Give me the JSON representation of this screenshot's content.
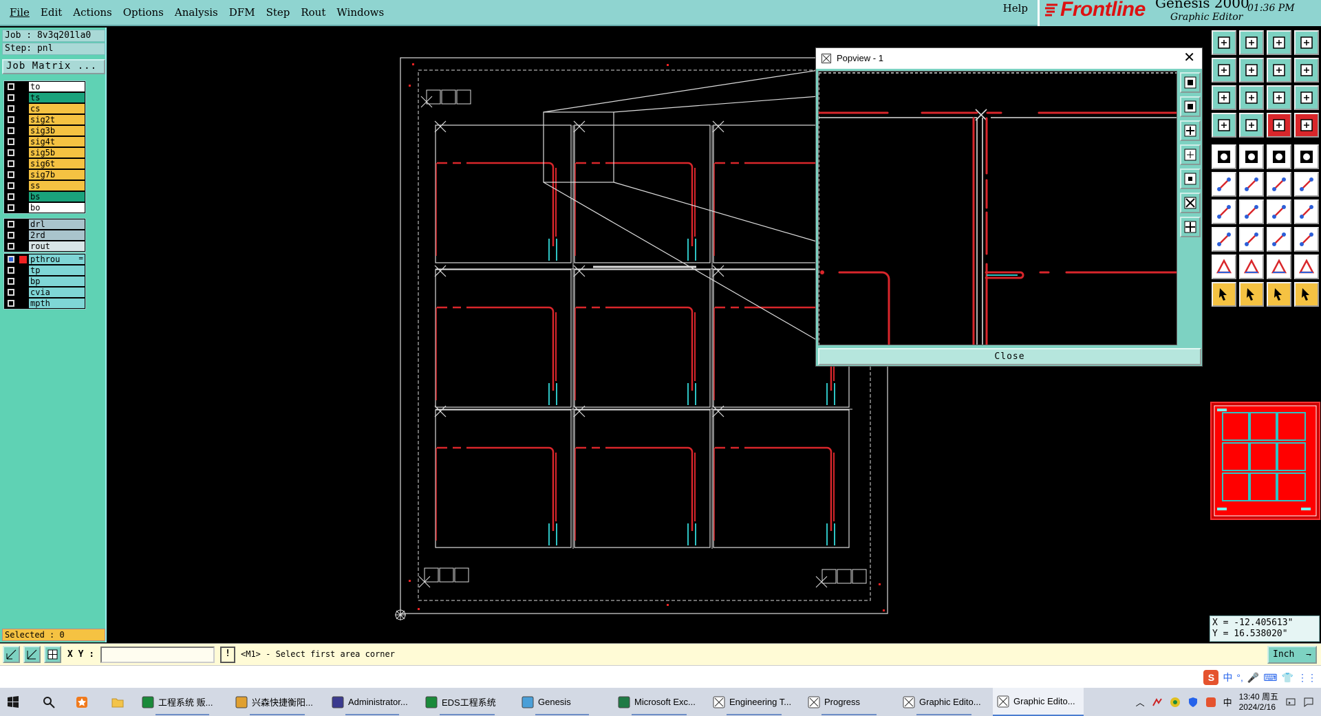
{
  "menubar": {
    "items": [
      "File",
      "Edit",
      "Actions",
      "Options",
      "Analysis",
      "DFM",
      "Step",
      "Rout",
      "Windows"
    ],
    "help": "Help"
  },
  "logo": {
    "brand": "Frontline",
    "product": "Genesis 2000",
    "subtitle": "Graphic Editor",
    "time": "01:36 PM"
  },
  "left_panel": {
    "job_line": "Job : 8v3q201la0",
    "step_line": "Step: pnl",
    "job_matrix_button": "Job Matrix ...",
    "layer_groups": [
      [
        {
          "name": "to",
          "color": "#ffffff"
        },
        {
          "name": "ts",
          "color": "#1aa37c"
        },
        {
          "name": "cs",
          "color": "#f5c242"
        },
        {
          "name": "sig2t",
          "color": "#f5c242"
        },
        {
          "name": "sig3b",
          "color": "#f5c242"
        },
        {
          "name": "sig4t",
          "color": "#f5c242"
        },
        {
          "name": "sig5b",
          "color": "#f5c242"
        },
        {
          "name": "sig6t",
          "color": "#f5c242"
        },
        {
          "name": "sig7b",
          "color": "#f5c242"
        },
        {
          "name": "ss",
          "color": "#f5c242"
        },
        {
          "name": "bs",
          "color": "#1aa37c"
        },
        {
          "name": "bo",
          "color": "#ffffff"
        }
      ],
      [
        {
          "name": "drl",
          "color": "#a9c4cc"
        },
        {
          "name": "2rd",
          "color": "#a9c4cc"
        },
        {
          "name": "rout",
          "color": "#d9e6e8"
        }
      ],
      [
        {
          "name": "pthrou",
          "color": "#7fd6d6",
          "active": true,
          "marker": "="
        },
        {
          "name": "tp",
          "color": "#7fd6d6"
        },
        {
          "name": "bp",
          "color": "#7fd6d6"
        },
        {
          "name": "cvia",
          "color": "#7fd6d6"
        },
        {
          "name": "mpth",
          "color": "#7fd6d6"
        }
      ]
    ],
    "selected": "Selected : 0"
  },
  "popview": {
    "title": "Popview - 1",
    "close_button": "Close"
  },
  "coords": {
    "x": "X = -12.405613\"",
    "y": "Y = 16.538020\""
  },
  "command_bar": {
    "xy_label": "X Y :",
    "xy_value": "",
    "prompt": "<M1> - Select first area corner",
    "units": "Inch"
  },
  "taskbar": {
    "items": [
      {
        "label": "工程系统  贩...",
        "icon_color": "#1a8a3a",
        "icon": "P"
      },
      {
        "label": "兴森快捷衡阳...",
        "icon_color": "#e0a030",
        "icon": "folder"
      },
      {
        "label": "Administrator...",
        "icon_color": "#3b3b8f",
        "icon": "disk"
      },
      {
        "label": "EDS工程系统",
        "icon_color": "#1a8a3a",
        "icon": "P"
      },
      {
        "label": "Genesis",
        "icon_color": "#4a9fd8",
        "icon": "g"
      },
      {
        "label": "Microsoft Exc...",
        "icon_color": "#1f7a45",
        "icon": "X"
      },
      {
        "label": "Engineering T...",
        "icon_color": "#555",
        "icon": "win"
      },
      {
        "label": "Progress",
        "icon_color": "#555",
        "icon": "win"
      },
      {
        "label": "Graphic Edito...",
        "icon_color": "#555",
        "icon": "win"
      },
      {
        "label": "Graphic Edito...",
        "icon_color": "#555",
        "icon": "win",
        "active": true
      }
    ],
    "clock_time": "13:40 周五",
    "clock_date": "2024/2/16",
    "ime_lang": "中"
  },
  "strip": {
    "ime_items": [
      "中",
      "°,",
      "🎤",
      "⌨",
      "👕",
      "⋮⋮"
    ]
  },
  "colors": {
    "teal": "#8fd4d0",
    "green_panel": "#5fd2b4",
    "red_trace": "#d9262b",
    "cyan_trace": "#2ec4c4"
  }
}
